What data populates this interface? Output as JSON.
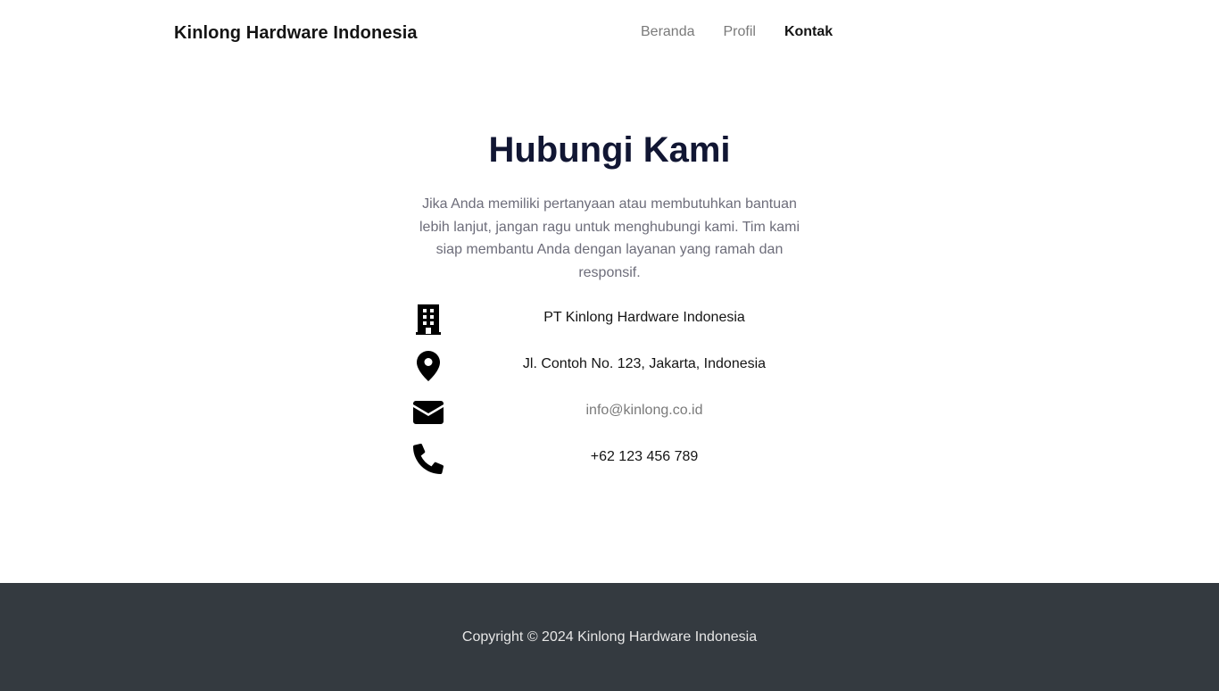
{
  "header": {
    "brand": "Kinlong Hardware Indonesia",
    "nav": [
      {
        "label": "Beranda",
        "active": false
      },
      {
        "label": "Profil",
        "active": false
      },
      {
        "label": "Kontak",
        "active": true
      }
    ]
  },
  "hero": {
    "title_plain": "Hubungi",
    "title_highlight": "Kami",
    "intro": "Jika Anda memiliki pertanyaan atau membutuhkan bantuan lebih lanjut, jangan ragu untuk menghubungi kami. Tim kami siap membantu Anda dengan layanan yang ramah dan responsif."
  },
  "contacts": [
    {
      "icon": "building-icon",
      "text": "PT Kinlong Hardware Indonesia"
    },
    {
      "icon": "map-marker-icon",
      "text": "Jl. Contoh No. 123, Jakarta, Indonesia"
    },
    {
      "icon": "envelope-icon",
      "text": "info@kinlong.co.id"
    },
    {
      "icon": "phone-icon",
      "text": "+62 123 456 789"
    }
  ],
  "footer": {
    "copyright": "Copyright © 2024 Kinlong Hardware Indonesia"
  },
  "colors": {
    "heading": "#111633",
    "highlight": "#f7d200",
    "footer_bg": "#343a40"
  }
}
